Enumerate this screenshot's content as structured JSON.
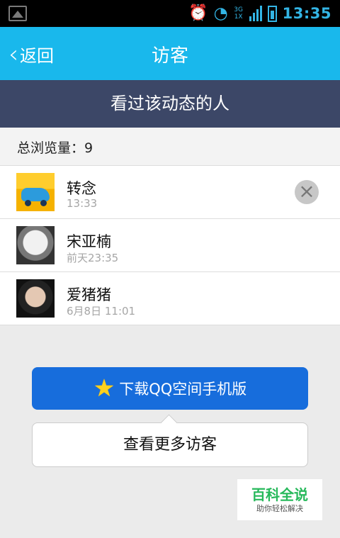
{
  "status_bar": {
    "time": "13:35",
    "network_top": "3G",
    "network_bottom": "1X"
  },
  "title_bar": {
    "back_label": "返回",
    "title": "访客"
  },
  "section": {
    "title": "看过该动态的人"
  },
  "summary": {
    "label": "总浏览量：9"
  },
  "visitors": [
    {
      "name": "转念",
      "time": "13:33",
      "has_remove": true
    },
    {
      "name": "宋亚楠",
      "time": "前天23:35",
      "has_remove": false
    },
    {
      "name": "爱猪猪",
      "time": "6月8日 11:01",
      "has_remove": false
    }
  ],
  "actions": {
    "download_label": "下载QQ空间手机版",
    "more_visitors_label": "查看更多访客"
  },
  "watermark": {
    "title": "百科全说",
    "subtitle": "助你轻松解决"
  },
  "colors": {
    "title_bar": "#19b8ec",
    "section_header": "#3c4767",
    "download_button": "#176ddc",
    "status_icons": "#33b5e5",
    "watermark": "#27b95b"
  },
  "icons": [
    "gallery-icon",
    "alarm-icon",
    "wifi-icon",
    "cellular-signal-icon",
    "battery-icon",
    "back-chevron-icon",
    "remove-icon",
    "star-icon"
  ]
}
